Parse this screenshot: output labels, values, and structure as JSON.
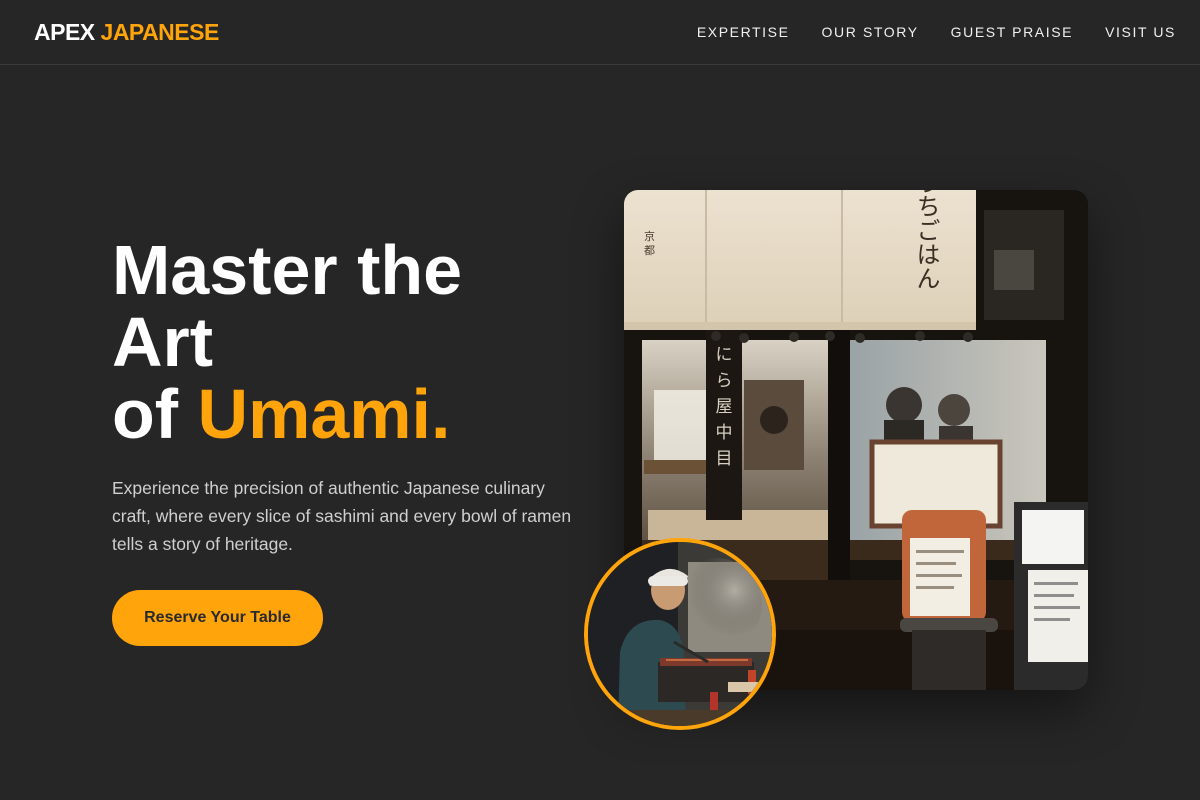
{
  "brand": {
    "name_primary": "APEX",
    "name_accent": "JAPANESE"
  },
  "nav": {
    "items": [
      {
        "label": "EXPERTISE"
      },
      {
        "label": "OUR STORY"
      },
      {
        "label": "GUEST PRAISE"
      },
      {
        "label": "VISIT US"
      }
    ]
  },
  "hero": {
    "title_line1": "Master the",
    "title_line2": "Art",
    "title_line3_prefix": "of",
    "title_accent": "Umami.",
    "description": "Experience the precision of authentic Japanese culinary craft, where every slice of sashimi and every bowl of ramen tells a story of heritage.",
    "cta_label": "Reserve Your Table"
  },
  "images": {
    "main": {
      "noren_text": "おうちごはん"
    }
  },
  "colors": {
    "accent": "#ffa40a",
    "background": "#262626",
    "text": "#ffffff"
  }
}
